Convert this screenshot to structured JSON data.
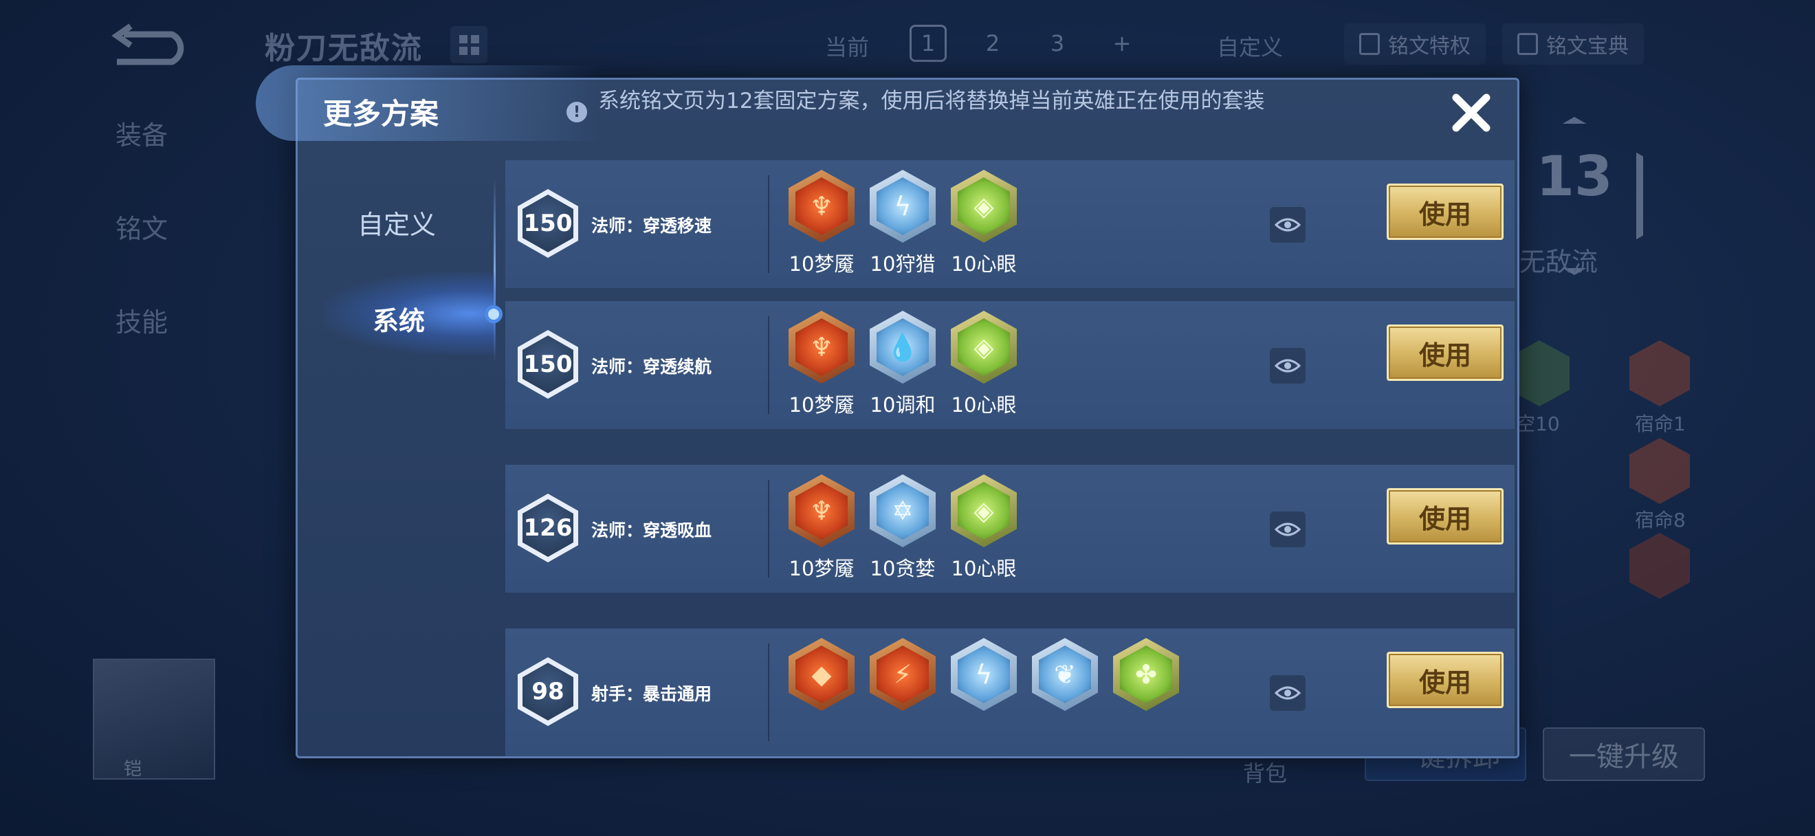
{
  "background": {
    "scheme_title": "粉刀无敌流",
    "page_label": "当前",
    "pages": [
      "1",
      "2",
      "3",
      "+"
    ],
    "custom_link": "自定义",
    "header_buttons": [
      "铭文特权",
      "铭文宝典"
    ],
    "sidebar": [
      "装备",
      "铭文",
      "技能"
    ],
    "level_badge": "13",
    "scheme_name_partial": "无敌流",
    "right_runes": [
      {
        "label": "空10"
      },
      {
        "label": "宿命1"
      },
      {
        "label": "宿命8"
      }
    ],
    "hero_name": "铠",
    "bag_label": "背包",
    "swap_label": "一键拆卸",
    "oneclick_label": "一键升级"
  },
  "modal": {
    "title": "更多方案",
    "notice": "系统铭文页为12套固定方案，使用后将替换掉当前英雄正在使用的套装",
    "tabs": [
      "自定义",
      "系统"
    ],
    "active_tab": "系统",
    "use_label": "使用",
    "rows": [
      {
        "level": "150",
        "name": "法师：穿透移速",
        "runes": [
          {
            "label": "10梦魇",
            "color": "red",
            "glyph": "♆"
          },
          {
            "label": "10狩猎",
            "color": "blue",
            "glyph": "ϟ"
          },
          {
            "label": "10心眼",
            "color": "green",
            "glyph": "◈"
          }
        ]
      },
      {
        "level": "150",
        "name": "法师：穿透续航",
        "runes": [
          {
            "label": "10梦魇",
            "color": "red",
            "glyph": "♆"
          },
          {
            "label": "10调和",
            "color": "blue",
            "glyph": "💧"
          },
          {
            "label": "10心眼",
            "color": "green",
            "glyph": "◈"
          }
        ]
      },
      {
        "level": "126",
        "name": "法师：穿透吸血",
        "runes": [
          {
            "label": "10梦魇",
            "color": "red",
            "glyph": "♆"
          },
          {
            "label": "10贪婪",
            "color": "blue",
            "glyph": "✡"
          },
          {
            "label": "10心眼",
            "color": "green",
            "glyph": "◈"
          }
        ]
      },
      {
        "level": "98",
        "name": "射手：暴击通用",
        "runes": [
          {
            "label": "",
            "color": "red",
            "glyph": "◆"
          },
          {
            "label": "",
            "color": "red",
            "glyph": "⚡"
          },
          {
            "label": "",
            "color": "blue",
            "glyph": "ϟ"
          },
          {
            "label": "",
            "color": "blue",
            "glyph": "❦"
          },
          {
            "label": "",
            "color": "green",
            "glyph": "✤"
          }
        ]
      }
    ]
  }
}
